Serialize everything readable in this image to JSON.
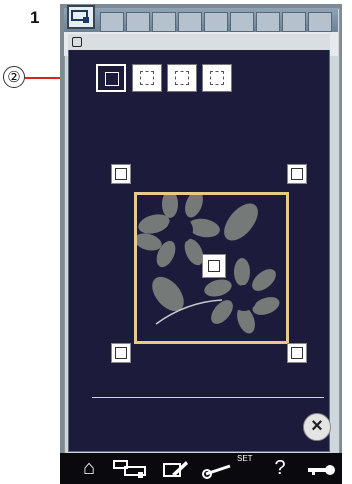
{
  "step": "1",
  "callout": "②",
  "bottom_bar": {
    "home": "⌂",
    "set_label": "SET",
    "help": "?",
    "key": "⊸"
  },
  "dialog": {
    "close_glyph": "×"
  },
  "colors": {
    "dialog_bg": "#1d1b3b",
    "frame": "#e8c98b",
    "flower": "#757a78",
    "callout_line": "#dd2222"
  },
  "icons": [
    "home-icon",
    "machine-icon",
    "edit-icon",
    "settings-icon",
    "help-icon",
    "key-icon"
  ]
}
